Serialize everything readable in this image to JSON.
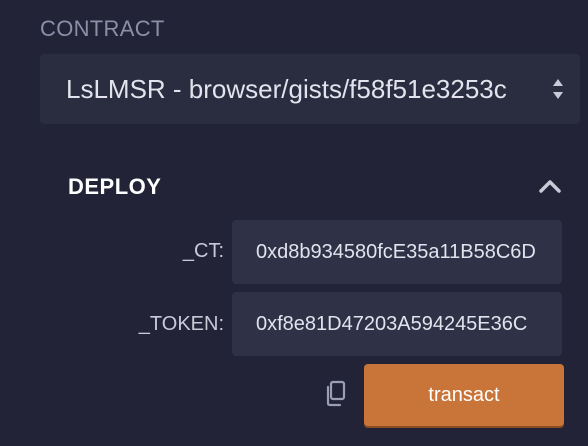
{
  "contract": {
    "label": "CONTRACT",
    "selected": "LsLMSR - browser/gists/f58f51e3253c"
  },
  "deploy": {
    "title": "DEPLOY",
    "params": [
      {
        "label": "_CT:",
        "value": "0xd8b934580fcE35a11B58C6D"
      },
      {
        "label": "_TOKEN:",
        "value": "0xf8e81D47203A594245E36C"
      }
    ],
    "transact_label": "transact"
  },
  "colors": {
    "background": "#222336",
    "input_bg": "#2f3146",
    "accent": "#c97539"
  },
  "icons": {
    "select": "select-arrows-icon",
    "collapse": "chevron-up-icon",
    "copy": "copy-icon"
  }
}
